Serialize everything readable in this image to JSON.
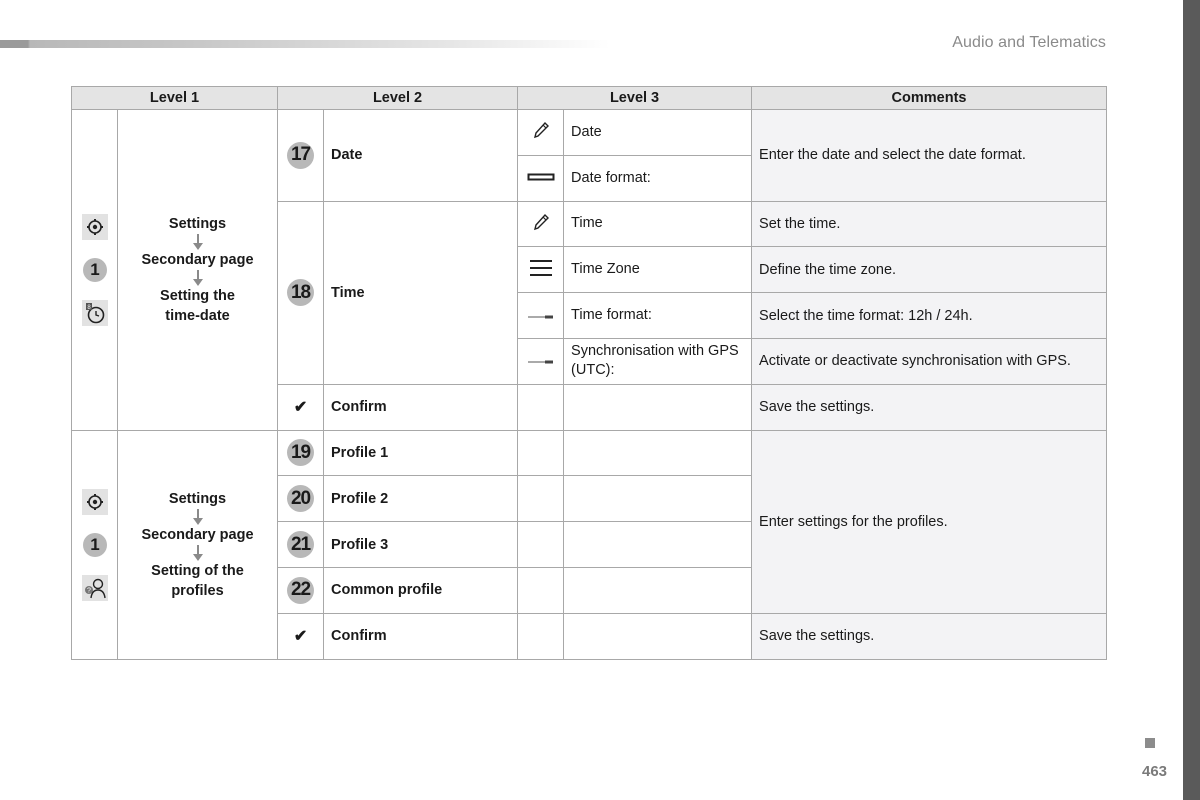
{
  "header": {
    "section_title": "Audio and Telematics"
  },
  "footer": {
    "page_number": "463"
  },
  "table": {
    "columns": [
      "Level 1",
      "Level 2",
      "Level 3",
      "Comments"
    ],
    "groups": [
      {
        "level1": {
          "icons": [
            "settings-gear-icon",
            "number-1-icon",
            "clock-icon"
          ],
          "badge_number": "1",
          "steps": [
            "Settings",
            "Secondary page",
            "Setting the time-date"
          ]
        },
        "rows": [
          {
            "num": "17",
            "label": "Date",
            "sub": [
              {
                "icon": "pencil-icon",
                "label": "Date"
              },
              {
                "icon": "rectangle-icon",
                "label": "Date format:"
              }
            ],
            "comment": "Enter the date and select the date format."
          },
          {
            "num": "18",
            "label": "Time",
            "sub": [
              {
                "icon": "pencil-icon",
                "label": "Time",
                "comment": "Set the time."
              },
              {
                "icon": "list-icon",
                "label": "Time Zone",
                "comment": "Define the time zone."
              },
              {
                "icon": "toggle-icon",
                "label": "Time format:",
                "comment": "Select the time format: 12h / 24h."
              },
              {
                "icon": "toggle-icon",
                "label": "Synchronisation with GPS (UTC):",
                "comment": "Activate or deactivate synchronisation with GPS."
              }
            ]
          },
          {
            "icon": "checkmark-icon",
            "check": "✔",
            "label": "Confirm",
            "comment": "Save the settings."
          }
        ]
      },
      {
        "level1": {
          "icons": [
            "settings-gear-icon",
            "number-1-icon",
            "profile-icon"
          ],
          "badge_number": "1",
          "steps": [
            "Settings",
            "Secondary page",
            "Setting of the profiles"
          ]
        },
        "rows": [
          {
            "num": "19",
            "label": "Profile 1"
          },
          {
            "num": "20",
            "label": "Profile 2"
          },
          {
            "num": "21",
            "label": "Profile 3"
          },
          {
            "num": "22",
            "label": "Common profile"
          },
          {
            "icon": "checkmark-icon",
            "check": "✔",
            "label": "Confirm",
            "comment": "Save the settings."
          }
        ],
        "profiles_comment": "Enter settings for the profiles."
      }
    ]
  }
}
